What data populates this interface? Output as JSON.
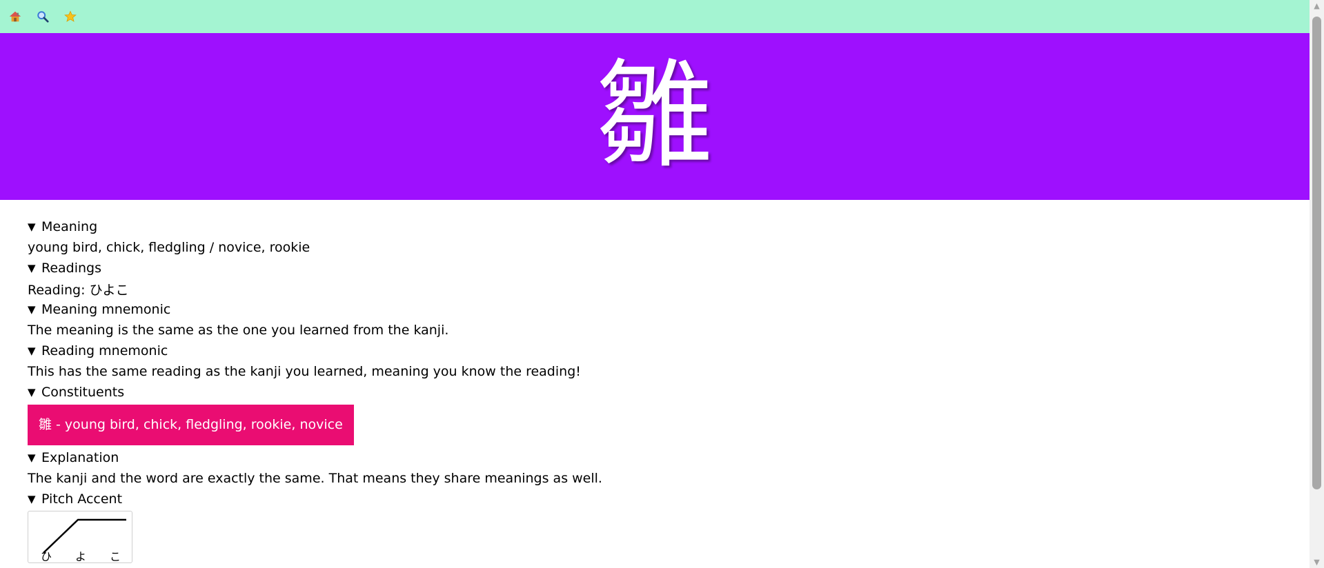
{
  "toolbar": {
    "icons": [
      "home-icon",
      "search-icon",
      "star-icon"
    ]
  },
  "hero": {
    "kanji": "雛",
    "background": "#9e10fe"
  },
  "sections": {
    "meaning": {
      "heading": "Meaning",
      "body": "young bird, chick, fledgling / novice, rookie"
    },
    "readings": {
      "heading": "Readings",
      "body": "Reading: ひよこ"
    },
    "meaning_mnemonic": {
      "heading": "Meaning mnemonic",
      "body": "The meaning is the same as the one you learned from the kanji."
    },
    "reading_mnemonic": {
      "heading": "Reading mnemonic",
      "body": "This has the same reading as the kanji you learned, meaning you know the reading!"
    },
    "constituents": {
      "heading": "Constituents",
      "items": [
        "雛 - young bird, chick, fledgling, rookie, novice"
      ]
    },
    "explanation": {
      "heading": "Explanation",
      "body": "The kanji and the word are exactly the same. That means they share meanings as well."
    },
    "pitch_accent": {
      "heading": "Pitch Accent",
      "morae": [
        "ひ",
        "よ",
        "こ"
      ],
      "pattern": [
        "low",
        "high",
        "high"
      ]
    }
  },
  "colors": {
    "toolbar": "#a4f4d2",
    "constituent": "#ea0d72"
  },
  "triangle": "▼"
}
